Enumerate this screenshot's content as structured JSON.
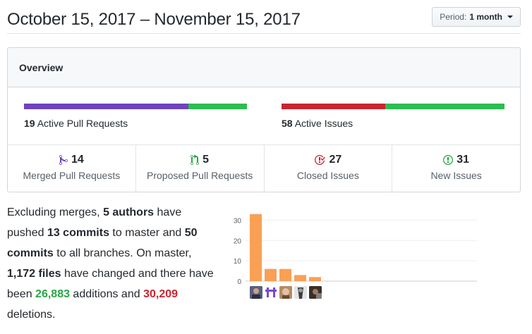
{
  "header": {
    "title": "October 15, 2017 – November 15, 2017",
    "period_prefix": "Period:",
    "period_value": "1 month"
  },
  "overview": {
    "title": "Overview",
    "pull_requests": {
      "count": "19",
      "label": "Active Pull Requests",
      "merged_fraction": 0.737
    },
    "issues": {
      "count": "58",
      "label": "Active Issues",
      "closed_fraction": 0.466
    },
    "stats": [
      {
        "count": "14",
        "label": "Merged Pull Requests",
        "icon": "git-merge-icon",
        "color": "#6f42c1"
      },
      {
        "count": "5",
        "label": "Proposed Pull Requests",
        "icon": "git-pull-request-icon",
        "color": "#28a745"
      },
      {
        "count": "27",
        "label": "Closed Issues",
        "icon": "issue-closed-icon",
        "color": "#cb2431"
      },
      {
        "count": "31",
        "label": "New Issues",
        "icon": "issue-opened-icon",
        "color": "#28a745"
      }
    ]
  },
  "summary": {
    "t1": "Excluding merges, ",
    "authors": "5 authors",
    "t2": " have pushed ",
    "commits_master": "13 commits",
    "t3": " to master and ",
    "commits_all": "50 commits",
    "t4": " to all branches. On master, ",
    "files": "1,172 files",
    "t5": " have changed and there have been ",
    "additions": "26,883",
    "t6": " additions",
    "t7": " and ",
    "deletions": "30,209",
    "t8": " deletions",
    "t9": "."
  },
  "chart_data": {
    "type": "bar",
    "categories": [
      "author-1",
      "author-2",
      "author-3",
      "author-4",
      "author-5"
    ],
    "values": [
      33,
      6,
      6,
      3,
      2
    ],
    "ylim": [
      0,
      35
    ],
    "yticks": [
      "0",
      "10",
      "20",
      "30"
    ],
    "bar_color": "#f9a055",
    "grid": true
  },
  "colors": {
    "merged": "#6f42c1",
    "open": "#2cbe4e",
    "closed": "#cb2431"
  }
}
